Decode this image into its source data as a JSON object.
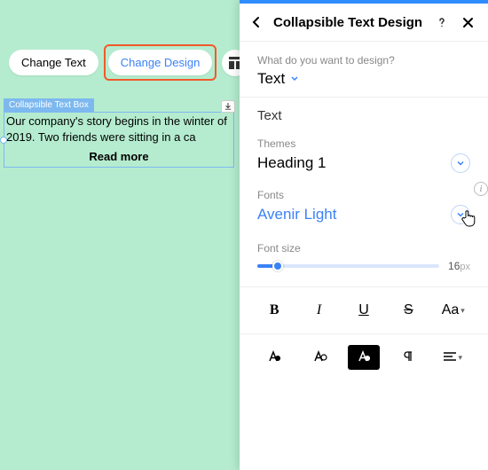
{
  "toolbar": {
    "change_text": "Change Text",
    "change_design": "Change Design"
  },
  "text_box": {
    "label": "Collapsible Text Box",
    "content": "Our company's story begins in the winter of 2019. Two friends were sitting in a ca",
    "read_more": "Read more"
  },
  "panel": {
    "title": "Collapsible Text Design",
    "design_prompt": "What do you want to design?",
    "design_target": "Text",
    "subheading": "Text",
    "themes_label": "Themes",
    "themes_value": "Heading 1",
    "fonts_label": "Fonts",
    "fonts_value": "Avenir Light",
    "font_size_label": "Font size",
    "font_size_value": "16",
    "font_size_unit": "px",
    "case_label": "Aa"
  }
}
